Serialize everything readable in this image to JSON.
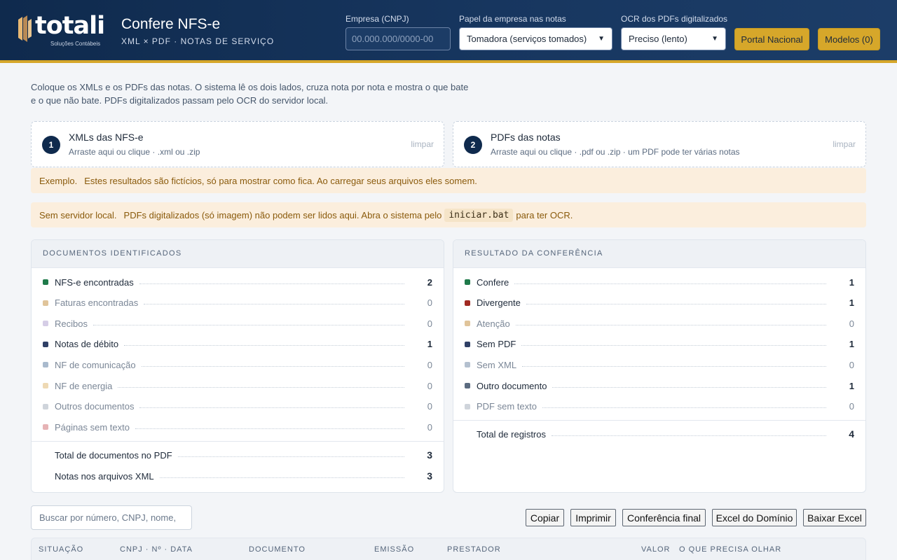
{
  "header": {
    "logo_text": "totali",
    "logo_sub": "Soluções Contábeis",
    "title": "Confere NFS-e",
    "subtitle": "XML × PDF · NOTAS DE SERVIÇO",
    "cnpj_label": "Empresa (CNPJ)",
    "cnpj_placeholder": "00.000.000/0000-00",
    "cnpj_value": "",
    "papel_label": "Papel da empresa nas notas",
    "papel_value": "Tomadora (serviços tomados)",
    "ocr_label": "OCR dos PDFs digitalizados",
    "ocr_value": "Preciso (lento)",
    "portal_button": "Portal Nacional",
    "modelos_button": "Modelos (0)"
  },
  "intro": "Coloque os XMLs e os PDFs das notas. O sistema lê os dois lados, cruza nota por nota e mostra o que bate e o que não bate. PDFs digitalizados passam pelo OCR do servidor local.",
  "dropzones": [
    {
      "num": "1",
      "title": "XMLs das NFS-e",
      "hint": "Arraste aqui ou clique · .xml ou .zip",
      "clear": "limpar"
    },
    {
      "num": "2",
      "title": "PDFs das notas",
      "hint": "Arraste aqui ou clique · .pdf ou .zip · um PDF pode ter várias notas",
      "clear": "limpar"
    }
  ],
  "notices": {
    "example_strong": "Exemplo.",
    "example_text": "Estes resultados são fictícios, só para mostrar como fica. Ao carregar seus arquivos eles somem.",
    "server_strong": "Sem servidor local.",
    "server_text_before": "PDFs digitalizados (só imagem) não podem ser lidos aqui. Abra o sistema pelo",
    "server_code": "iniciar.bat",
    "server_text_after": "para ter OCR."
  },
  "documents_panel": {
    "title": "DOCUMENTOS IDENTIFICADOS",
    "rows": [
      {
        "label": "NFS-e encontradas",
        "value": "2",
        "color": "#1f7a4a"
      },
      {
        "label": "Faturas encontradas",
        "value": "0",
        "color": "#e0c49a"
      },
      {
        "label": "Recibos",
        "value": "0",
        "color": "#d5cde6"
      },
      {
        "label": "Notas de débito",
        "value": "1",
        "color": "#2f4066"
      },
      {
        "label": "NF de comunicação",
        "value": "0",
        "color": "#a9bacd"
      },
      {
        "label": "NF de energia",
        "value": "0",
        "color": "#eed9b4"
      },
      {
        "label": "Outros documentos",
        "value": "0",
        "color": "#cfd4db"
      },
      {
        "label": "Páginas sem texto",
        "value": "0",
        "color": "#e6b3b5"
      }
    ],
    "totals": [
      {
        "label": "Total de documentos no PDF",
        "value": "3"
      },
      {
        "label": "Notas nos arquivos XML",
        "value": "3"
      }
    ]
  },
  "result_panel": {
    "title": "RESULTADO DA CONFERÊNCIA",
    "rows": [
      {
        "label": "Confere",
        "value": "1",
        "color": "#1f7a4a"
      },
      {
        "label": "Divergente",
        "value": "1",
        "color": "#a12a22"
      },
      {
        "label": "Atenção",
        "value": "0",
        "color": "#e0c49a"
      },
      {
        "label": "Sem PDF",
        "value": "1",
        "color": "#2f4066"
      },
      {
        "label": "Sem XML",
        "value": "0",
        "color": "#b4c0cf"
      },
      {
        "label": "Outro documento",
        "value": "1",
        "color": "#5b6b80"
      },
      {
        "label": "PDF sem texto",
        "value": "0",
        "color": "#cfd4db"
      }
    ],
    "totals": [
      {
        "label": "Total de registros",
        "value": "4"
      }
    ]
  },
  "toolbar": {
    "search_placeholder": "Buscar por número, CNPJ, nome,",
    "copy": "Copiar",
    "print": "Imprimir",
    "final_check": "Conferência final",
    "excel_dominio": "Excel do Domínio",
    "download_excel": "Baixar Excel"
  },
  "table": {
    "columns": [
      "SITUAÇÃO",
      "CNPJ · Nº · DATA",
      "DOCUMENTO",
      "EMISSÃO",
      "PRESTADOR",
      "VALOR",
      "O QUE PRECISA OLHAR"
    ]
  }
}
